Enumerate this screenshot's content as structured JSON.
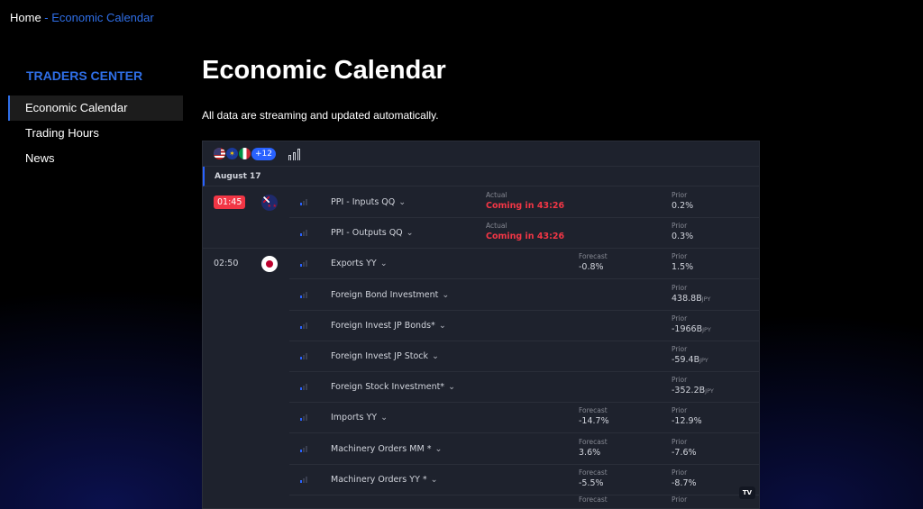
{
  "breadcrumb": {
    "home": "Home",
    "separator": " - ",
    "current": "Economic Calendar"
  },
  "sidebar": {
    "title": "TRADERS CENTER",
    "items": [
      {
        "label": "Economic Calendar",
        "active": true
      },
      {
        "label": "Trading Hours",
        "active": false
      },
      {
        "label": "News",
        "active": false
      }
    ]
  },
  "page": {
    "title": "Economic Calendar",
    "subtitle": "All data are streaming and updated automatically."
  },
  "widget": {
    "more_countries": "+12",
    "date": "August 17",
    "logo": "TV",
    "labels": {
      "actual": "Actual",
      "forecast": "Forecast",
      "prior": "Prior"
    },
    "events": [
      {
        "time": "01:45",
        "country_icon": "new-zealand-flag",
        "name": "PPI - Inputs QQ",
        "chevron": "⌄",
        "actual": "Coming in 43:26",
        "forecast": "",
        "prior": "0.2%",
        "prior_unit": ""
      },
      {
        "time": "",
        "country_icon": "",
        "name": "PPI - Outputs QQ",
        "chevron": "⌄",
        "actual": "Coming in 43:26",
        "forecast": "",
        "prior": "0.3%",
        "prior_unit": ""
      },
      {
        "time": "02:50",
        "country_icon": "japan-flag",
        "name": "Exports YY",
        "chevron": "⌄",
        "actual": "",
        "forecast": "-0.8%",
        "prior": "1.5%",
        "prior_unit": ""
      },
      {
        "time": "",
        "country_icon": "",
        "name": "Foreign Bond Investment",
        "chevron": "⌄",
        "actual": "",
        "forecast": "",
        "prior": "438.8B",
        "prior_unit": "JPY"
      },
      {
        "time": "",
        "country_icon": "",
        "name": "Foreign Invest JP Bonds*",
        "chevron": "⌄",
        "actual": "",
        "forecast": "",
        "prior": "-1966B",
        "prior_unit": "JPY"
      },
      {
        "time": "",
        "country_icon": "",
        "name": "Foreign Invest JP Stock",
        "chevron": "⌄",
        "actual": "",
        "forecast": "",
        "prior": "-59.4B",
        "prior_unit": "JPY"
      },
      {
        "time": "",
        "country_icon": "",
        "name": "Foreign Stock Investment*",
        "chevron": "⌄",
        "actual": "",
        "forecast": "",
        "prior": "-352.2B",
        "prior_unit": "JPY"
      },
      {
        "time": "",
        "country_icon": "",
        "name": "Imports YY",
        "chevron": "⌄",
        "actual": "",
        "forecast": "-14.7%",
        "prior": "-12.9%",
        "prior_unit": ""
      },
      {
        "time": "",
        "country_icon": "",
        "name": "Machinery Orders MM *",
        "chevron": "⌄",
        "actual": "",
        "forecast": "3.6%",
        "prior": "-7.6%",
        "prior_unit": ""
      },
      {
        "time": "",
        "country_icon": "",
        "name": "Machinery Orders YY *",
        "chevron": "⌄",
        "actual": "",
        "forecast": "-5.5%",
        "prior": "-8.7%",
        "prior_unit": ""
      }
    ]
  },
  "colors": {
    "accent": "#2f6fe8",
    "alert": "#f23645",
    "panel": "#1e222d"
  }
}
